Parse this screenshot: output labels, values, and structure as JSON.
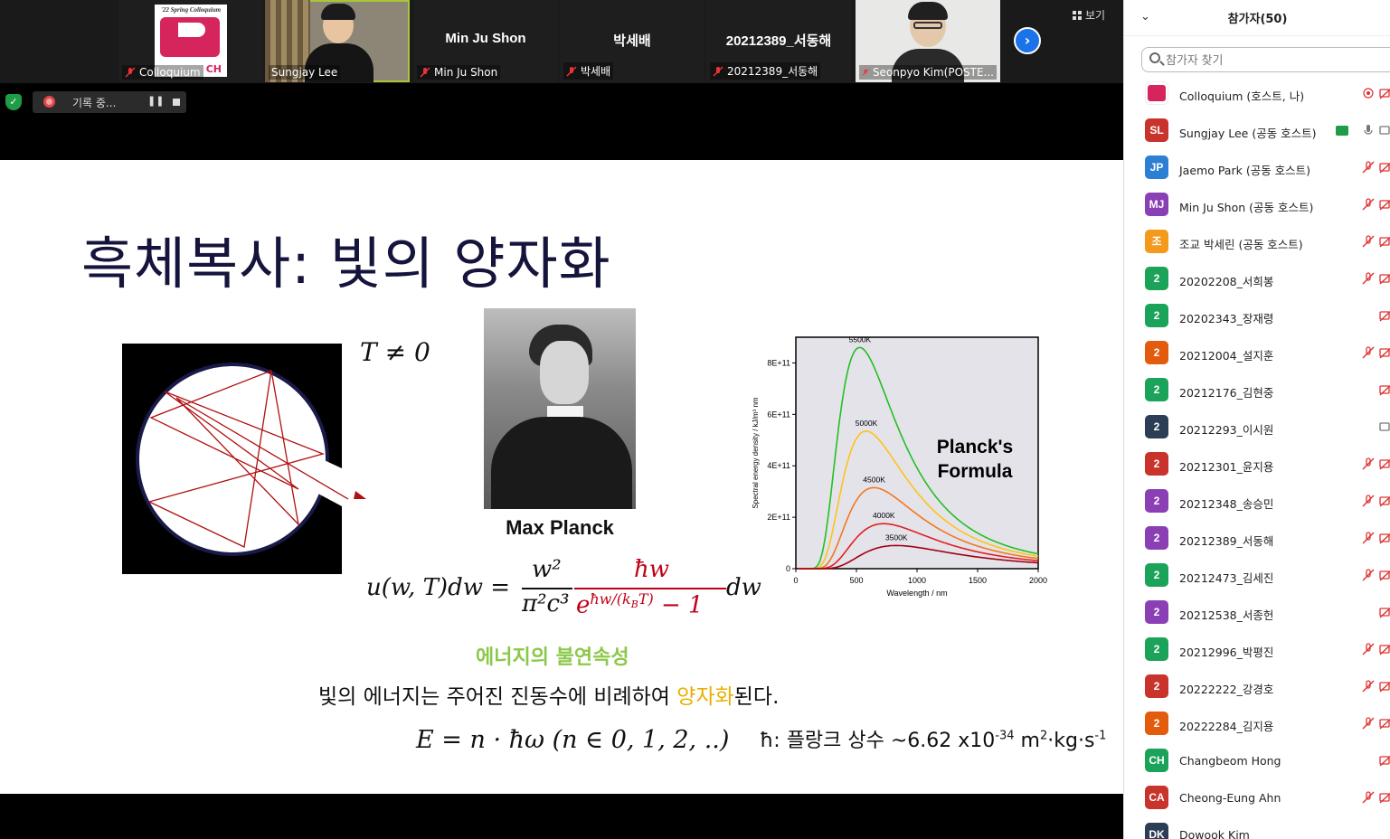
{
  "strip": {
    "tiles": [
      {
        "label": "Colloquium",
        "logo_text": "'22 Spring Colloquium",
        "logo_sub": "CH"
      },
      {
        "label": "Sungjay Lee"
      },
      {
        "center": "Min Ju Shon",
        "label": "Min Ju Shon"
      },
      {
        "center": "박세배",
        "label": "박세배"
      },
      {
        "center": "20212389_서동해",
        "label": "20212389_서동해"
      },
      {
        "label": "Seonpyo Kim(POSTE..."
      }
    ],
    "view_label": "보기",
    "recording_label": "기록 중...",
    "pause_glyph": "❚❚"
  },
  "slide": {
    "title": "흑체복사: 빛의 양자화",
    "temperature": "T ≠ 0",
    "portrait_caption": "Max Planck",
    "formula": {
      "lhs": "u(w, T)dw =",
      "num1": "w²",
      "den1": "π²c³",
      "num2": "ħw",
      "den2": "e^{ħw/(k_B T)} − 1",
      "den2_base": "e",
      "den2_exp": "ħw/(k",
      "den2_sub": "B",
      "den2_exp_end": "T)",
      "den2_tail": " − 1",
      "tail": "dw"
    },
    "discontinuity": "에너지의 불연속성",
    "statement_pre": "빛의 에너지는 주어진 진동수에 비례하여 ",
    "statement_hl": "양자화",
    "statement_post": "된다.",
    "energy_eq": "E = n · ħω   (n ∈ 0, 1, 2, ..)",
    "hbar_note_pre": "ħ: 플랑크 상수 ~6.62 x10",
    "hbar_note_exp1": "-34",
    "hbar_note_mid": " m",
    "hbar_note_exp2": "2",
    "hbar_note_post": "·kg·s",
    "hbar_note_exp3": "-1"
  },
  "chart_data": {
    "type": "line",
    "title": "Planck's Formula",
    "xlabel": "Wavelength / nm",
    "ylabel": "Spectral energy density / kJ/m³ nm",
    "xlim": [
      0,
      2000
    ],
    "ylim": [
      0,
      900000000000.0
    ],
    "xticks": [
      "0",
      "500",
      "1000",
      "1500",
      "2000"
    ],
    "yticks": [
      "0",
      "2E+11",
      "4E+11",
      "6E+11",
      "8E+11"
    ],
    "series": [
      {
        "name": "5500K",
        "peak_nm": 527,
        "peak": 860000000000.0,
        "color": "#22c022"
      },
      {
        "name": "5000K",
        "peak_nm": 580,
        "peak": 535000000000.0,
        "color": "#ffc21a"
      },
      {
        "name": "4500K",
        "peak_nm": 644,
        "peak": 315000000000.0,
        "color": "#f07820"
      },
      {
        "name": "4000K",
        "peak_nm": 724,
        "peak": 175000000000.0,
        "color": "#e02020"
      },
      {
        "name": "3500K",
        "peak_nm": 828,
        "peak": 90000000000.0,
        "color": "#a00010"
      }
    ]
  },
  "panel": {
    "title": "참가자(50)",
    "collapse_glyph": "⌄",
    "search_placeholder": "참가자 찾기",
    "participants": [
      {
        "avatar": "",
        "name": "Colloquium (호스트, 나)",
        "color": "#ffffff",
        "logo": true,
        "mic": "rec"
      },
      {
        "avatar": "SL",
        "name": "Sungjay Lee (공동 호스트)",
        "color": "#c8332b",
        "mic": "on",
        "share": true,
        "cam": "on"
      },
      {
        "avatar": "JP",
        "name": "Jaemo Park (공동 호스트)",
        "color": "#2d7fd3",
        "mic": "off",
        "cam": "off"
      },
      {
        "avatar": "MJ",
        "name": "Min Ju Shon (공동 호스트)",
        "color": "#8a3fb5",
        "mic": "off",
        "cam": "off"
      },
      {
        "avatar": "조",
        "name": "조교 박세린 (공동 호스트)",
        "color": "#f39a1c",
        "mic": "off",
        "cam": "off"
      },
      {
        "avatar": "2",
        "name": "20202208_서희봉",
        "color": "#1ba35a",
        "mic": "off",
        "cam": "off"
      },
      {
        "avatar": "2",
        "name": "20202343_장재령",
        "color": "#1ba35a",
        "mic": "none",
        "cam": "off"
      },
      {
        "avatar": "2",
        "name": "20212004_설지훈",
        "color": "#e35b0c",
        "mic": "off",
        "cam": "off"
      },
      {
        "avatar": "2",
        "name": "20212176_김현중",
        "color": "#1ba35a",
        "mic": "none",
        "cam": "off"
      },
      {
        "avatar": "2",
        "name": "20212293_이시원",
        "color": "#2c3e55",
        "mic": "none",
        "cam": "on"
      },
      {
        "avatar": "2",
        "name": "20212301_윤지용",
        "color": "#c8332b",
        "mic": "off",
        "cam": "off"
      },
      {
        "avatar": "2",
        "name": "20212348_송승민",
        "color": "#8a3fb5",
        "mic": "off",
        "cam": "off"
      },
      {
        "avatar": "2",
        "name": "20212389_서동해",
        "color": "#8a3fb5",
        "mic": "off",
        "cam": "off"
      },
      {
        "avatar": "2",
        "name": "20212473_김세진",
        "color": "#1ba35a",
        "mic": "off",
        "cam": "off"
      },
      {
        "avatar": "2",
        "name": "20212538_서종헌",
        "color": "#8a3fb5",
        "mic": "none",
        "cam": "off"
      },
      {
        "avatar": "2",
        "name": "20212996_박평진",
        "color": "#1ba35a",
        "mic": "off",
        "cam": "off"
      },
      {
        "avatar": "2",
        "name": "20222222_강경호",
        "color": "#c8332b",
        "mic": "off",
        "cam": "off"
      },
      {
        "avatar": "2",
        "name": "20222284_김지용",
        "color": "#e35b0c",
        "mic": "off",
        "cam": "off"
      },
      {
        "avatar": "CH",
        "name": "Changbeom Hong",
        "color": "#1ba35a",
        "mic": "none",
        "cam": "off"
      },
      {
        "avatar": "CA",
        "name": "Cheong-Eung Ahn",
        "color": "#c8332b",
        "mic": "off",
        "cam": "off"
      },
      {
        "avatar": "DK",
        "name": "Dowook Kim",
        "color": "#2c3e55",
        "mic": "none",
        "cam": "none"
      }
    ]
  }
}
